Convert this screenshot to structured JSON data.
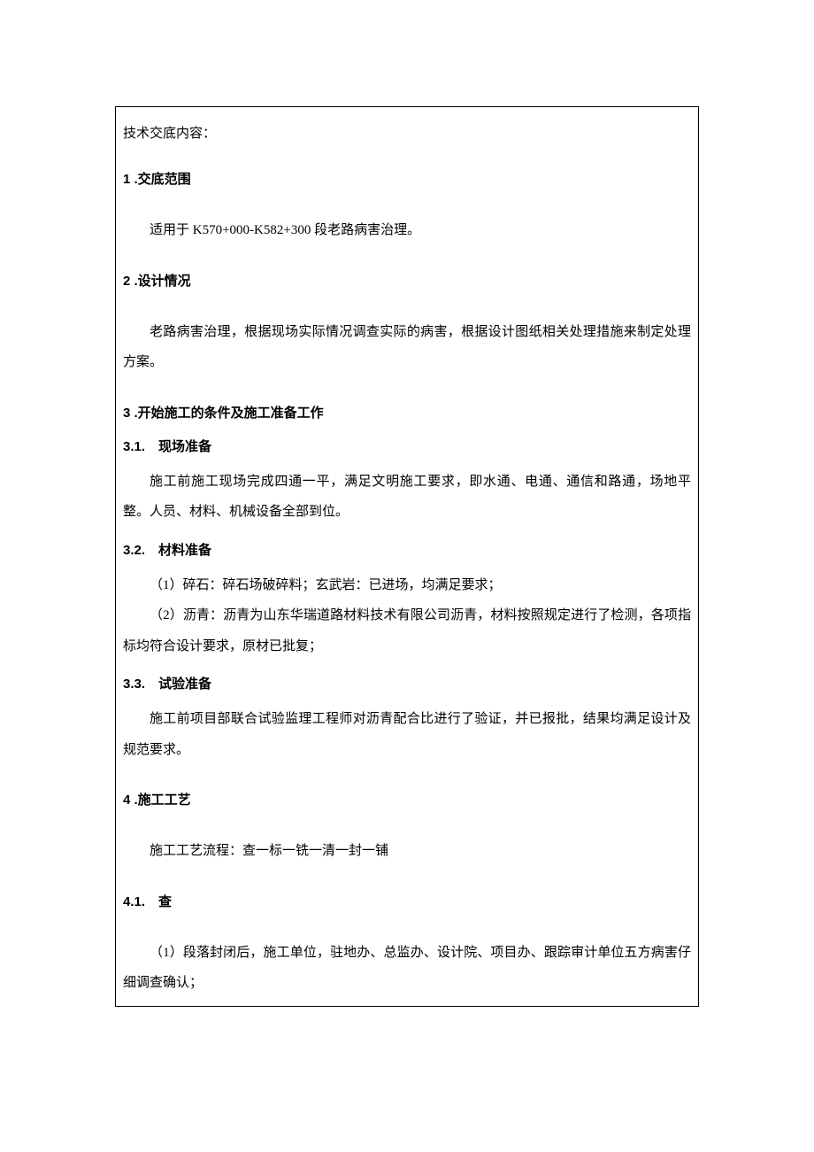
{
  "intro": "技术交底内容：",
  "sections": {
    "s1": {
      "num": "1",
      "title": " .交底范围",
      "p1": "适用于 K570+000-K582+300 段老路病害治理。"
    },
    "s2": {
      "num": "2",
      "title": " .设计情况",
      "p1": "老路病害治理，根据现场实际情况调查实际的病害，根据设计图纸相关处理措施来制定处理方案。"
    },
    "s3": {
      "num": "3",
      "title": " .开始施工的条件及施工准备工作",
      "s31": {
        "num": "3.1.",
        "title": "　现场准备",
        "p1": "施工前施工现场完成四通一平，满足文明施工要求，即水通、电通、通信和路通，场地平整。人员、材料、机械设备全部到位。"
      },
      "s32": {
        "num": "3.2.",
        "title": "　材料准备",
        "p1": "（1）碎石：碎石场破碎料；玄武岩：已进场，均满足要求；",
        "p2": "（2）沥青：沥青为山东华瑞道路材料技术有限公司沥青，材料按照规定进行了检测，各项指标均符合设计要求，原材已批复；"
      },
      "s33": {
        "num": "3.3.",
        "title": "　试验准备",
        "p1": "施工前项目部联合试验监理工程师对沥青配合比进行了验证，并已报批，结果均满足设计及规范要求。"
      }
    },
    "s4": {
      "num": "4",
      "title": " .施工工艺",
      "p1": "施工工艺流程：查一标一铣一清一封一铺",
      "s41": {
        "num": "4.1.",
        "title": "　查",
        "p1": "（1）段落封闭后，施工单位，驻地办、总监办、设计院、项目办、跟踪审计单位五方病害仔细调查确认；"
      }
    }
  }
}
